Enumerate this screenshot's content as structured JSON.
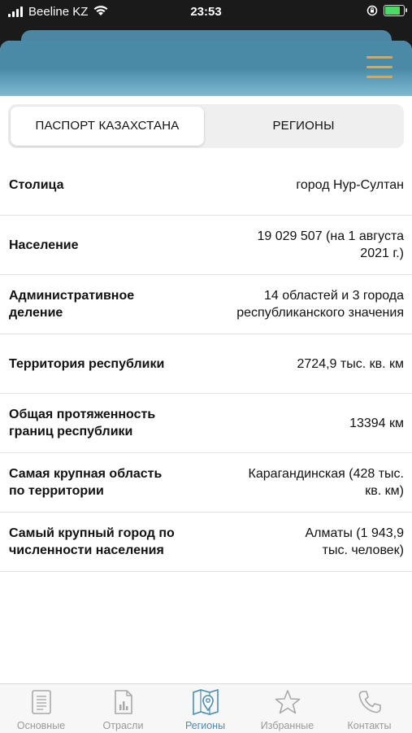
{
  "status_bar": {
    "carrier": "Beeline KZ",
    "time": "23:53",
    "battery_color": "#4cd964"
  },
  "header": {
    "gradient_top": "#4b8aa6",
    "menu_icon_color": "#f4a12d"
  },
  "segments": {
    "active": "ПАСПОРТ КАЗАХСТАНА",
    "inactive": "РЕГИОНЫ"
  },
  "rows": [
    {
      "label": [
        "Столица"
      ],
      "value": [
        "город Нур-Султан"
      ]
    },
    {
      "label": [
        "Население"
      ],
      "value": [
        "19 029 507 (на 1 августа",
        "2021 г.)"
      ]
    },
    {
      "label": [
        "Административное",
        "деление"
      ],
      "value": [
        "14 областей и 3 города",
        "республиканского значения"
      ]
    },
    {
      "label": [
        "Территория республики"
      ],
      "value": [
        "2724,9 тыс. кв. км"
      ]
    },
    {
      "label": [
        "Общая протяженность",
        "границ республики"
      ],
      "value": [
        "13394 км"
      ]
    },
    {
      "label": [
        "Самая крупная область",
        "по территории"
      ],
      "value": [
        "Карагандинская (428 тыс.",
        "кв. км)"
      ]
    },
    {
      "label": [
        "Самый крупный город по",
        "численности населения"
      ],
      "value": [
        "Алматы (1 943,9",
        "тыс. человек)"
      ]
    }
  ],
  "tabs": [
    {
      "label": "Основные",
      "icon": "document-icon"
    },
    {
      "label": "Отрасли",
      "icon": "chart-document-icon"
    },
    {
      "label": "Регионы",
      "icon": "map-pin-icon",
      "active": true
    },
    {
      "label": "Избранные",
      "icon": "star-icon"
    },
    {
      "label": "Контакты",
      "icon": "phone-icon"
    }
  ],
  "tab_active_color": "#4a8db3"
}
